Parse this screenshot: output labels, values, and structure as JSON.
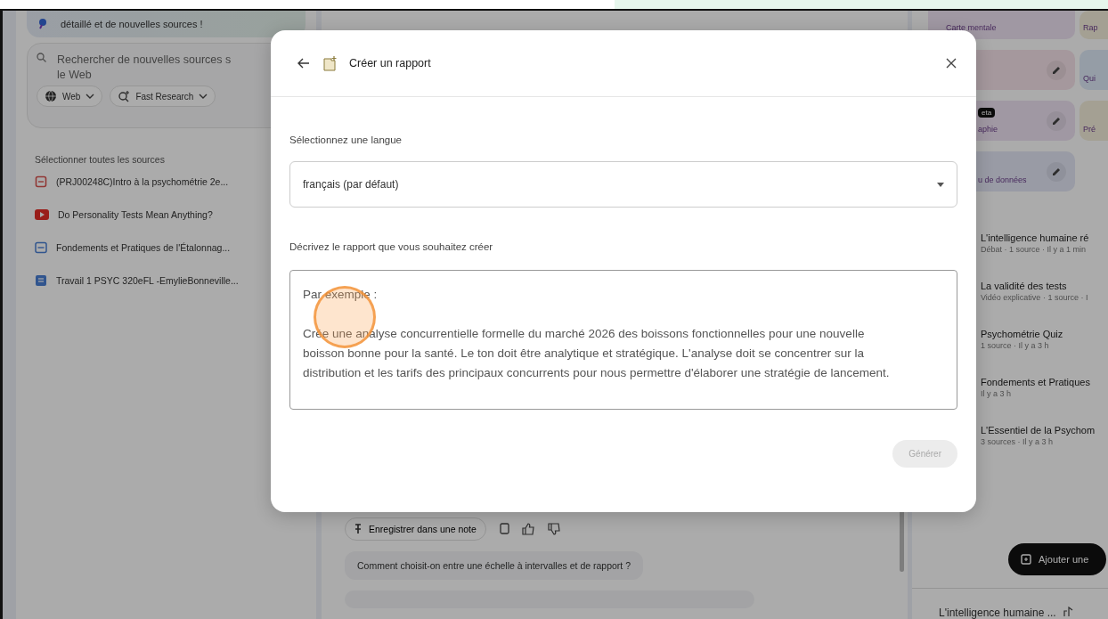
{
  "left_panel": {
    "banner_text": "détaillé et de nouvelles sources !",
    "search": {
      "placeholder": "Rechercher de nouvelles sources s\nle Web",
      "chips": [
        {
          "kind": "web",
          "label": "Web"
        },
        {
          "kind": "research",
          "label": "Fast Research"
        }
      ]
    },
    "select_all": "Sélectionner toutes les sources",
    "sources": [
      {
        "kind": "pdf",
        "title": "(PRJ00248C)Intro à la psychométrie 2e..."
      },
      {
        "kind": "youtube",
        "title": "Do Personality Tests Mean Anything?"
      },
      {
        "kind": "doc",
        "title": "Fondements et Pratiques de l'Étalonnag..."
      },
      {
        "kind": "gdoc",
        "title": "Travail 1 PSYC 320eFL -EmylieBonneville..."
      }
    ]
  },
  "chat_panel": {
    "save_note": "Enregistrer dans une note",
    "suggestion": "Comment choisit-on entre une échelle à intervalles et de rapport ?"
  },
  "studio_panel": {
    "tiles": [
      {
        "kind": "mindmap",
        "label": "Carte mentale",
        "editable": false
      },
      {
        "kind": "report",
        "label": "Rap"
      },
      {
        "kind": "audio",
        "editable": true
      },
      {
        "kind": "quiz",
        "label": "Qui"
      },
      {
        "kind": "infographic",
        "label": "aphie",
        "badge": "eta",
        "editable": true
      },
      {
        "kind": "slides",
        "label": "Pré"
      },
      {
        "kind": "table",
        "label": "u de données",
        "editable": true
      }
    ],
    "notes": [
      {
        "title": "L'intelligence humaine ré",
        "meta": "Débat · 1 source · Il y a 1 min"
      },
      {
        "title": "La validité des tests",
        "meta": "Vidéo explicative · 1 source · I"
      },
      {
        "title": "Psychométrie Quiz",
        "meta": "1 source · Il y a 3 h"
      },
      {
        "title": "Fondements et Pratiques",
        "meta": "Il y a 3 h"
      },
      {
        "title": "L'Essentiel de la Psychom",
        "meta": "3 sources · Il y a 3 h"
      }
    ],
    "add_note": "Ajouter une",
    "bottom_note": "L'intelligence humaine ..."
  },
  "dialog": {
    "title": "Créer un rapport",
    "language_label": "Sélectionnez une langue",
    "language_value": "français (par défaut)",
    "describe_label": "Décrivez le rapport que vous souhaitez créer",
    "description_placeholder": "Par exemple :\n\nCrée une analyse concurrentielle formelle du marché 2026 des boissons fonctionnelles pour une nouvelle boisson bonne pour la santé. Le ton doit être analytique et stratégique. L'analyse doit se concentrer sur la distribution et les tarifs des principaux concurrents pour nous permettre d'élaborer une stratégie de lancement.",
    "generate": {
      "label": "Générer",
      "disabled": true
    }
  }
}
